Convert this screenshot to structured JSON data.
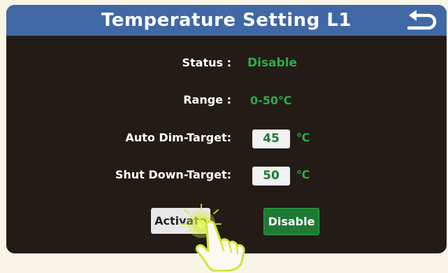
{
  "header": {
    "title": "Temperature Setting L1"
  },
  "icons": {
    "back": "back-arrow-icon",
    "pointer": "hand-pointer-icon"
  },
  "colors": {
    "header_bg": "#3f68a5",
    "panel_bg": "#231c16",
    "accent_green": "#2eab4a",
    "button_green": "#1f7a35"
  },
  "status": {
    "label": "Status :",
    "value": "Disable"
  },
  "range": {
    "label": "Range :",
    "value": "0-50℃"
  },
  "auto_dim": {
    "label": "Auto Dim-Target:",
    "value": "45",
    "unit": "℃"
  },
  "shut_down": {
    "label": "Shut Down-Target:",
    "value": "50",
    "unit": "℃"
  },
  "buttons": {
    "activate": "Activate",
    "disable": "Disable"
  }
}
